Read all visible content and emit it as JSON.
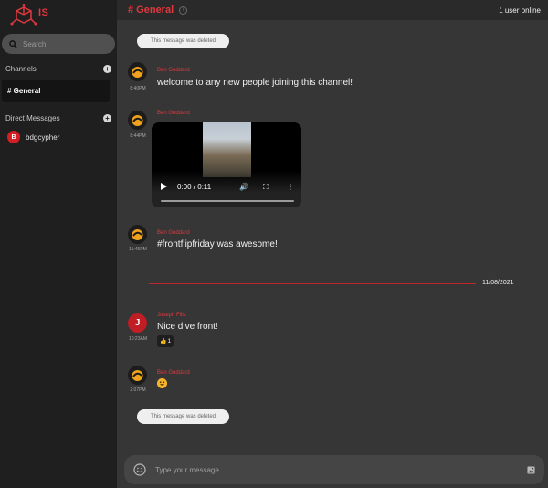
{
  "logo": {
    "text": "IS"
  },
  "search": {
    "placeholder": "Search"
  },
  "channels": {
    "heading": "Channels",
    "items": [
      {
        "label": "# General"
      }
    ]
  },
  "direct_messages": {
    "heading": "Direct Messages",
    "items": [
      {
        "initial": "B",
        "label": "bdgcypher"
      }
    ]
  },
  "header": {
    "channel": "# General",
    "online": "1 user online"
  },
  "messages": {
    "deleted_1": "This message was deleted",
    "m1": {
      "author": "Ben Goddard",
      "time": "8:40PM",
      "text": "welcome to any new people joining this channel!"
    },
    "m2": {
      "author": "Ben Goddard",
      "time": "8:44PM",
      "video_time": "0:00 / 0:11"
    },
    "m3": {
      "author": "Ben Goddard",
      "time": "11:45PM",
      "text": "#frontflipfriday was awesome!"
    },
    "date_divider": "11/08/2021",
    "m4": {
      "author": "Joseph Fills",
      "initial": "J",
      "time": "10:23AM",
      "text": "Nice dive front!",
      "reaction": "👍",
      "reaction_count": "1"
    },
    "m5": {
      "author": "Ben Goddard",
      "time": "2:07PM"
    },
    "deleted_2": "This message was deleted"
  },
  "composer": {
    "placeholder": "Type your message"
  },
  "colors": {
    "accent": "#e0383e",
    "sidebar": "#1f1f1f",
    "main": "#363636"
  }
}
